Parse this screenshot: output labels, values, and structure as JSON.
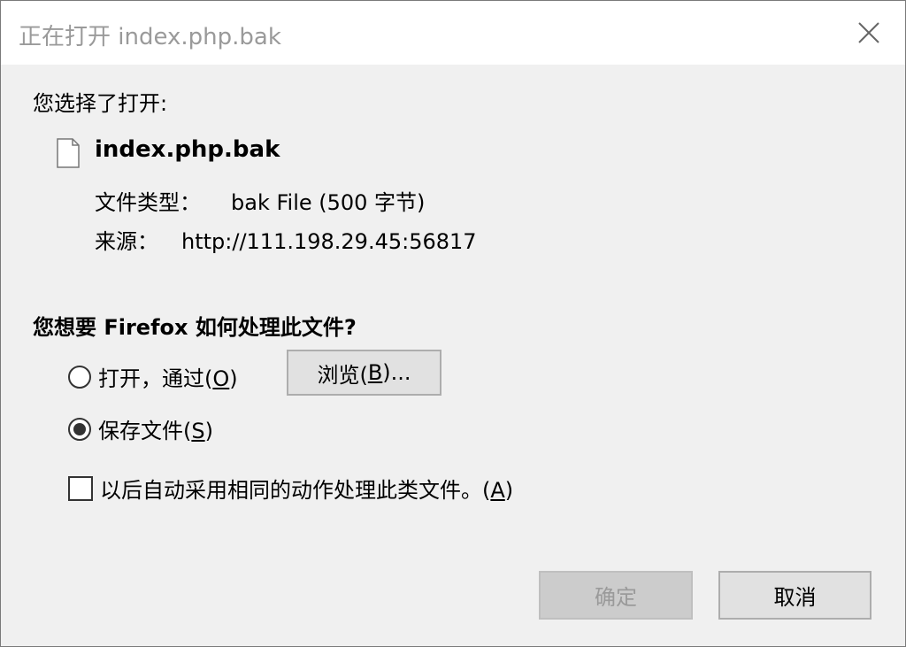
{
  "title": "正在打开 index.php.bak",
  "intro": "您选择了打开:",
  "file": {
    "name": "index.php.bak",
    "type_label": "文件类型：",
    "type_value": "bak File (500 字节)",
    "source_label": "来源：",
    "source_value": "http://111.198.29.45:56817"
  },
  "question": "您想要 Firefox 如何处理此文件?",
  "options": {
    "open_with": {
      "text": "打开，通过(",
      "key": "O",
      "close": ")",
      "selected": false
    },
    "browse_button": {
      "text": "浏览(",
      "key": "B",
      "close": ")..."
    },
    "save_file": {
      "text": "保存文件(",
      "key": "S",
      "close": ")",
      "selected": true
    },
    "remember": {
      "text": "以后自动采用相同的动作处理此类文件。(",
      "key": "A",
      "close": ")",
      "checked": false
    }
  },
  "buttons": {
    "ok": "确定",
    "cancel": "取消"
  },
  "icons": {
    "close": "close-icon",
    "file": "file-icon"
  }
}
